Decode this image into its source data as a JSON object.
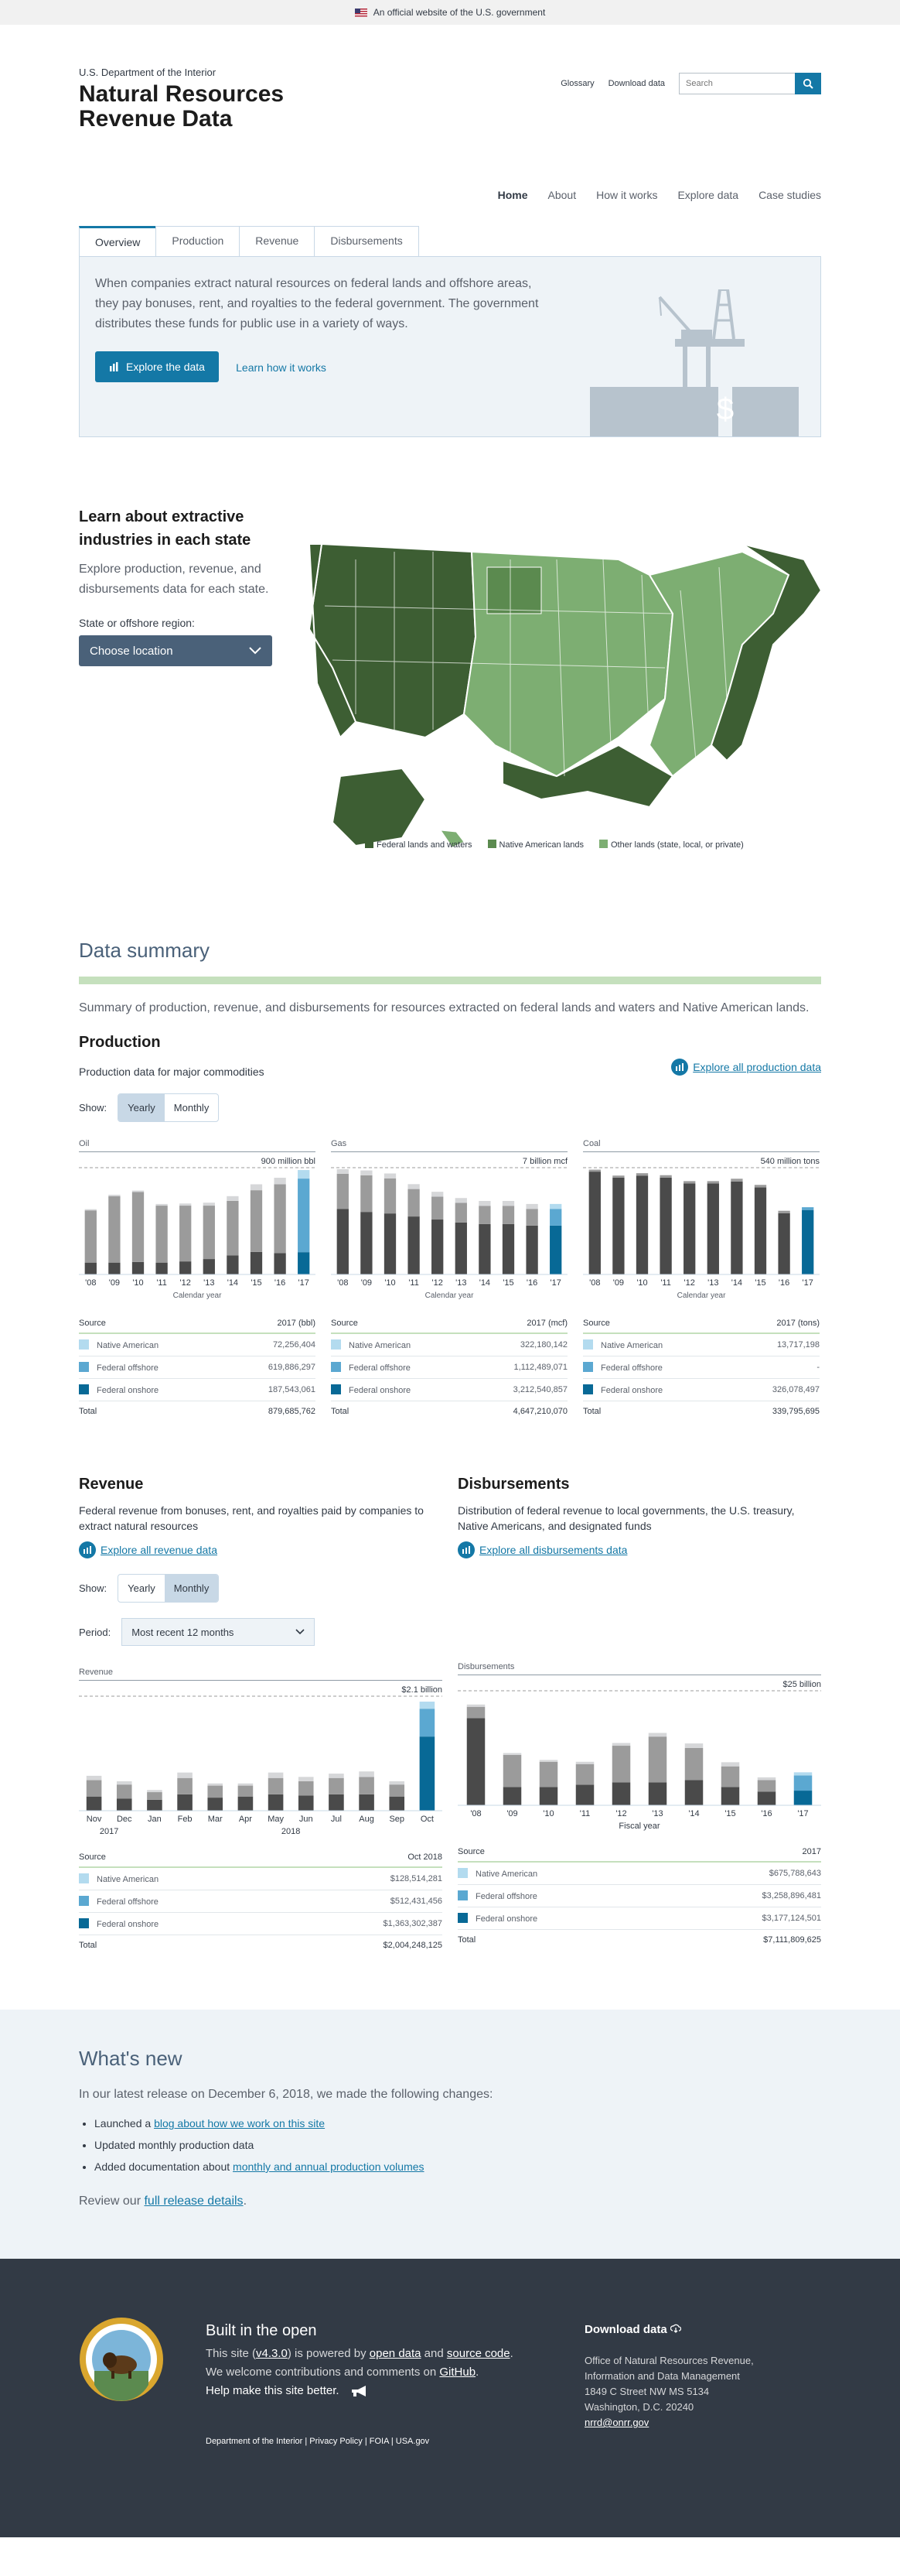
{
  "banner": {
    "text": "An official website of the U.S. government"
  },
  "header": {
    "department": "U.S. Department of the Interior",
    "title": "Natural Resources Revenue Data",
    "utility_links": [
      "Glossary",
      "Download data"
    ],
    "search_placeholder": "Search"
  },
  "nav": {
    "items": [
      "Home",
      "About",
      "How it works",
      "Explore data",
      "Case studies"
    ]
  },
  "hero": {
    "tabs": [
      "Overview",
      "Production",
      "Revenue",
      "Disbursements"
    ],
    "text": "When companies extract natural resources on federal lands and offshore areas, they pay bonuses, rent, and royalties to the federal government. The government distributes these funds for public use in a variety of ways.",
    "primary_button": "Explore the data",
    "secondary_link": "Learn how it works"
  },
  "states": {
    "heading": "Learn about extractive industries in each state",
    "text": "Explore production, revenue, and disbursements data for each state.",
    "label": "State or offshore region:",
    "select": "Choose location",
    "legend": [
      "Federal lands and waters",
      "Native American lands",
      "Other lands (state, local, or private)"
    ],
    "colors": {
      "federal": "#3d5e33",
      "native": "#5b8a4f",
      "other": "#7dae72"
    }
  },
  "summary": {
    "title": "Data summary",
    "intro": "Summary of production, revenue, and disbursements for resources extracted on federal lands and waters and Native American lands."
  },
  "production": {
    "title": "Production",
    "subtitle": "Production data for major commodities",
    "explore": "Explore all production data",
    "show_label": "Show:",
    "toggle": [
      "Yearly",
      "Monthly"
    ],
    "charts": [
      {
        "name": "Oil",
        "max_label": "900 million bbl",
        "xlabel": "Calendar year",
        "table_header": [
          "Source",
          "2017 (bbl)"
        ],
        "rows": [
          {
            "label": "Native American",
            "value": "72,256,404"
          },
          {
            "label": "Federal offshore",
            "value": "619,886,297"
          },
          {
            "label": "Federal onshore",
            "value": "187,543,061"
          }
        ],
        "total": "879,685,762"
      },
      {
        "name": "Gas",
        "max_label": "7 billion mcf",
        "xlabel": "Calendar year",
        "table_header": [
          "Source",
          "2017 (mcf)"
        ],
        "rows": [
          {
            "label": "Native American",
            "value": "322,180,142"
          },
          {
            "label": "Federal offshore",
            "value": "1,112,489,071"
          },
          {
            "label": "Federal onshore",
            "value": "3,212,540,857"
          }
        ],
        "total": "4,647,210,070"
      },
      {
        "name": "Coal",
        "max_label": "540 million tons",
        "xlabel": "Calendar year",
        "table_header": [
          "Source",
          "2017 (tons)"
        ],
        "rows": [
          {
            "label": "Native American",
            "value": "13,717,198"
          },
          {
            "label": "Federal offshore",
            "value": "-"
          },
          {
            "label": "Federal onshore",
            "value": "326,078,497"
          }
        ],
        "total": "339,795,695"
      }
    ]
  },
  "revenue": {
    "title": "Revenue",
    "text": "Federal revenue from bonuses, rent, and royalties paid by companies to extract natural resources",
    "explore": "Explore all revenue data",
    "show_label": "Show:",
    "toggle": [
      "Yearly",
      "Monthly"
    ],
    "period_label": "Period:",
    "period_value": "Most recent 12 months",
    "chart_title": "Revenue",
    "max_label": "$2.1 billion",
    "year_labels": [
      "2017",
      "2018"
    ],
    "table_header": [
      "Source",
      "Oct 2018"
    ],
    "rows": [
      {
        "label": "Native American",
        "value": "$128,514,281"
      },
      {
        "label": "Federal offshore",
        "value": "$512,431,456"
      },
      {
        "label": "Federal onshore",
        "value": "$1,363,302,387"
      }
    ],
    "total": "$2,004,248,125"
  },
  "disbursements": {
    "title": "Disbursements",
    "text": "Distribution of federal revenue to local governments, the U.S. treasury, Native Americans, and designated funds",
    "explore": "Explore all disbursements data",
    "chart_title": "Disbursements",
    "max_label": "$25 billion",
    "xlabel": "Fiscal year",
    "table_header": [
      "Source",
      "2017"
    ],
    "rows": [
      {
        "label": "Native American",
        "value": "$675,788,643"
      },
      {
        "label": "Federal offshore",
        "value": "$3,258,896,481"
      },
      {
        "label": "Federal onshore",
        "value": "$3,177,124,501"
      }
    ],
    "total": "$7,111,809,625"
  },
  "total_label": "Total",
  "colors": {
    "light": "#b3dbef",
    "mid": "#5ba8d1",
    "dark": "#086996",
    "gray_light": "#d6d7d9",
    "gray": "#9b9b9b",
    "gray_dark": "#4a4a4a"
  },
  "chart_data": [
    {
      "type": "bar",
      "title": "Oil",
      "ylabel": "900 million bbl",
      "categories": [
        "'08",
        "'09",
        "'10",
        "'11",
        "'12",
        "'13",
        "'14",
        "'15",
        "'16",
        "'17"
      ],
      "series": [
        {
          "name": "Federal onshore",
          "values": [
            100,
            100,
            105,
            100,
            110,
            130,
            160,
            190,
            180,
            188
          ]
        },
        {
          "name": "Federal offshore",
          "values": [
            440,
            560,
            590,
            480,
            470,
            450,
            460,
            520,
            580,
            620
          ]
        },
        {
          "name": "Native American",
          "values": [
            10,
            12,
            12,
            14,
            18,
            25,
            40,
            50,
            55,
            72
          ]
        }
      ],
      "ylim": [
        0,
        900
      ]
    },
    {
      "type": "bar",
      "title": "Gas",
      "ylabel": "7 billion mcf",
      "categories": [
        "'08",
        "'09",
        "'10",
        "'11",
        "'12",
        "'13",
        "'14",
        "'15",
        "'16",
        "'17"
      ],
      "series": [
        {
          "name": "Federal onshore",
          "values": [
            4300,
            4100,
            4000,
            3800,
            3600,
            3400,
            3300,
            3300,
            3200,
            3200
          ]
        },
        {
          "name": "Federal offshore",
          "values": [
            2300,
            2400,
            2300,
            1800,
            1500,
            1300,
            1200,
            1200,
            1100,
            1100
          ]
        },
        {
          "name": "Native American",
          "values": [
            300,
            320,
            320,
            320,
            320,
            310,
            320,
            320,
            320,
            322
          ]
        }
      ],
      "ylim": [
        0,
        7000
      ]
    },
    {
      "type": "bar",
      "title": "Coal",
      "ylabel": "540 million tons",
      "categories": [
        "'08",
        "'09",
        "'10",
        "'11",
        "'12",
        "'13",
        "'14",
        "'15",
        "'16",
        "'17"
      ],
      "series": [
        {
          "name": "Federal onshore",
          "values": [
            520,
            490,
            500,
            490,
            460,
            460,
            470,
            440,
            310,
            326
          ]
        },
        {
          "name": "Native American",
          "values": [
            10,
            10,
            12,
            12,
            12,
            12,
            14,
            13,
            12,
            14
          ]
        }
      ],
      "ylim": [
        0,
        540
      ]
    },
    {
      "type": "bar",
      "title": "Revenue",
      "ylabel": "$2.1 billion",
      "categories": [
        "Nov",
        "Dec",
        "Jan",
        "Feb",
        "Mar",
        "Apr",
        "May",
        "Jun",
        "Jul",
        "Aug",
        "Sep",
        "Oct"
      ],
      "series": [
        {
          "name": "Federal onshore",
          "values": [
            0.26,
            0.22,
            0.2,
            0.3,
            0.24,
            0.26,
            0.3,
            0.28,
            0.3,
            0.3,
            0.26,
            1.36
          ]
        },
        {
          "name": "Federal offshore",
          "values": [
            0.3,
            0.26,
            0.14,
            0.3,
            0.22,
            0.2,
            0.3,
            0.26,
            0.3,
            0.32,
            0.22,
            0.51
          ]
        },
        {
          "name": "Native American",
          "values": [
            0.08,
            0.06,
            0.04,
            0.1,
            0.04,
            0.04,
            0.1,
            0.08,
            0.08,
            0.1,
            0.06,
            0.13
          ]
        }
      ],
      "ylim": [
        0,
        2.1
      ]
    },
    {
      "type": "bar",
      "title": "Disbursements",
      "ylabel": "$25 billion",
      "categories": [
        "'08",
        "'09",
        "'10",
        "'11",
        "'12",
        "'13",
        "'14",
        "'15",
        "'16",
        "'17"
      ],
      "series": [
        {
          "name": "Federal onshore",
          "values": [
            19,
            4,
            4,
            4.5,
            5,
            5,
            5.5,
            4,
            3,
            3.2
          ]
        },
        {
          "name": "Federal offshore",
          "values": [
            2.5,
            7,
            5.5,
            4.5,
            8,
            10,
            7,
            4.5,
            2.5,
            3.3
          ]
        },
        {
          "name": "Native American",
          "values": [
            0.5,
            0.4,
            0.4,
            0.5,
            0.6,
            0.8,
            1,
            0.9,
            0.6,
            0.7
          ]
        }
      ],
      "ylim": [
        0,
        25
      ]
    }
  ],
  "whatsnew": {
    "title": "What's new",
    "intro": "In our latest release on December 6, 2018, we made the following changes:",
    "items": [
      {
        "before": "Launched a ",
        "link": "blog about how we work on this site",
        "after": ""
      },
      {
        "before": "Updated monthly production data",
        "link": "",
        "after": ""
      },
      {
        "before": "Added documentation about ",
        "link": "monthly and annual production volumes",
        "after": ""
      }
    ],
    "review_before": "Review our ",
    "review_link": "full release details",
    "review_after": "."
  },
  "footer": {
    "seal_text": "DEPARTMENT OF THE INTERIOR",
    "seal_subtext": "MARCH 3, 1849",
    "title": "Built in the open",
    "line1_a": "This site (",
    "version": "v4.3.0",
    "line1_b": ") is powered by ",
    "open_data": "open data",
    "and": " and ",
    "source_code": "source code",
    "line1_end": ".",
    "line2": "We welcome contributions and comments on ",
    "github": "GitHub",
    "line2_end": ".",
    "help": "Help make this site better.",
    "links": "Department of the Interior | Privacy Policy | FOIA | USA.gov",
    "download": "Download data",
    "office": [
      "Office of Natural Resources Revenue,",
      "Information and Data Management",
      "1849 C Street NW MS 5134",
      "Washington, D.C. 20240"
    ],
    "email": "nrrd@onrr.gov"
  }
}
